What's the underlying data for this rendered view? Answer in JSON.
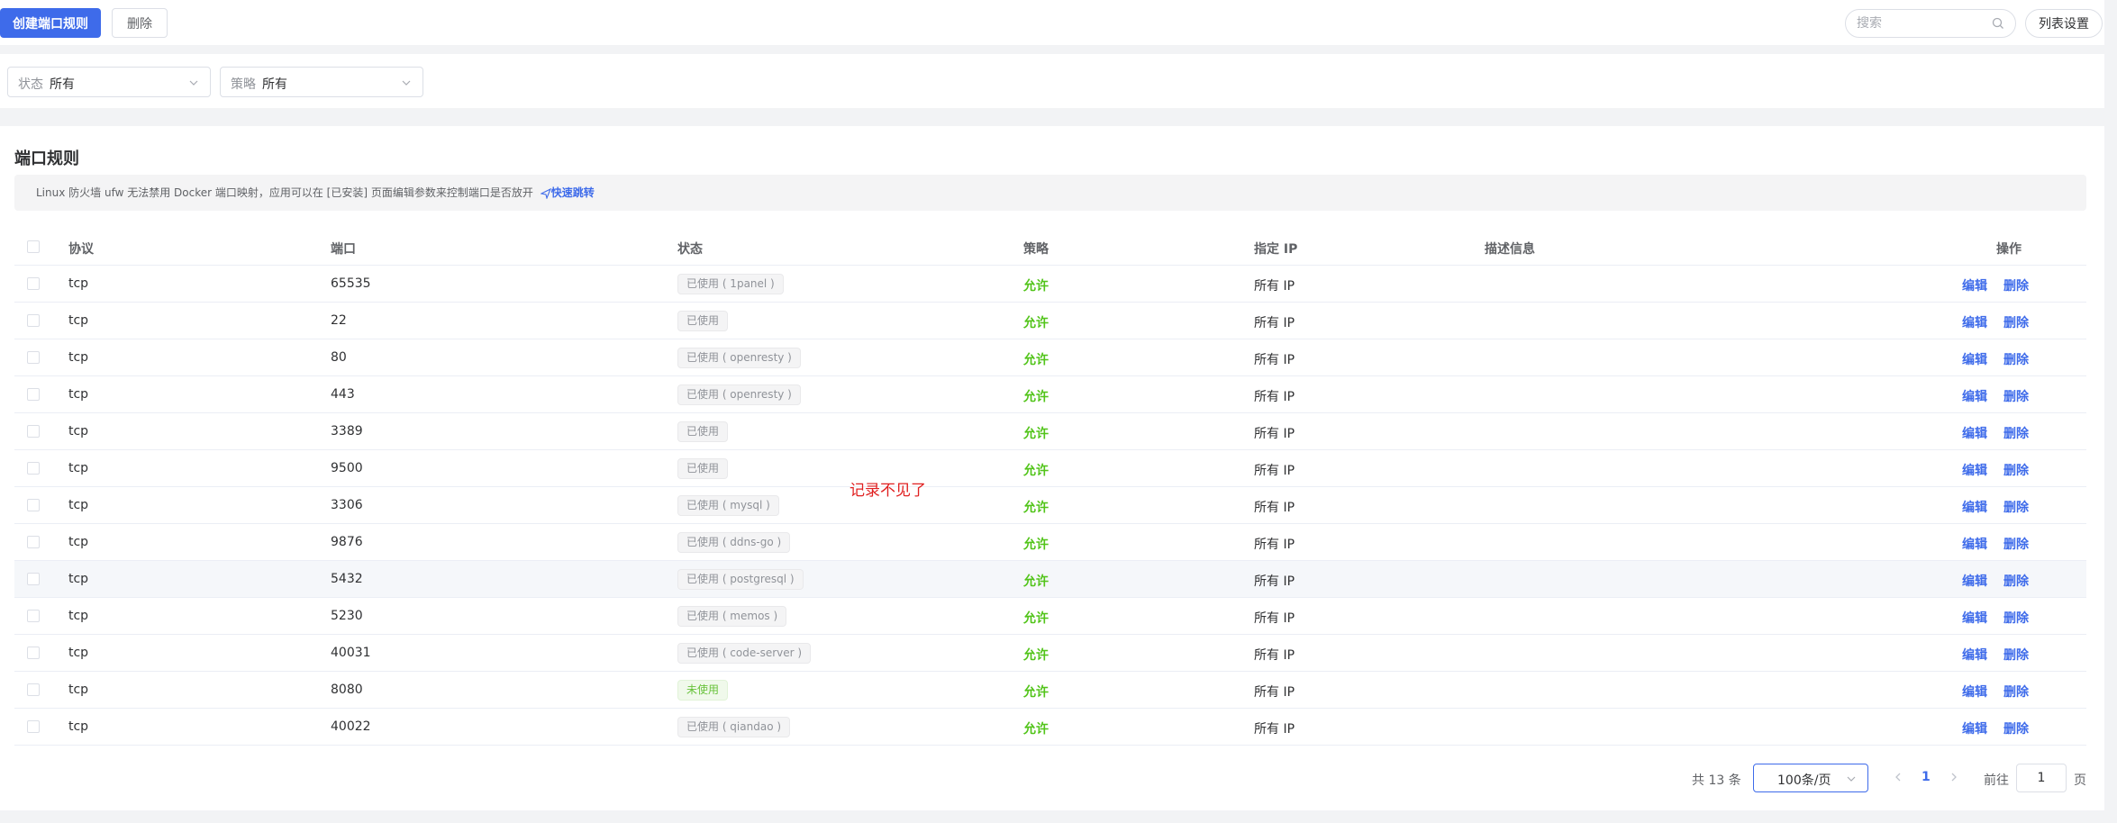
{
  "toolbar": {
    "create_label": "创建端口规则",
    "delete_label": "删除",
    "search_placeholder": "搜索",
    "settings_label": "列表设置"
  },
  "filters": {
    "status_label": "状态",
    "status_value": "所有",
    "policy_label": "策略",
    "policy_value": "所有"
  },
  "card": {
    "title": "端口规则",
    "notice": "Linux 防火墙 ufw 无法禁用 Docker 端口映射，应用可以在 [已安装] 页面编辑参数来控制端口是否放开",
    "notice_link": "快速跳转"
  },
  "table": {
    "headers": [
      "协议",
      "端口",
      "状态",
      "策略",
      "指定 IP",
      "描述信息",
      "操作"
    ],
    "edit_label": "编辑",
    "delete_label": "删除",
    "rows": [
      {
        "protocol": "tcp",
        "port": "65535",
        "status": "已使用 ( 1panel )",
        "used": true,
        "policy": "允许",
        "ip": "所有 IP",
        "desc": ""
      },
      {
        "protocol": "tcp",
        "port": "22",
        "status": "已使用",
        "used": true,
        "policy": "允许",
        "ip": "所有 IP",
        "desc": ""
      },
      {
        "protocol": "tcp",
        "port": "80",
        "status": "已使用 ( openresty )",
        "used": true,
        "policy": "允许",
        "ip": "所有 IP",
        "desc": ""
      },
      {
        "protocol": "tcp",
        "port": "443",
        "status": "已使用 ( openresty )",
        "used": true,
        "policy": "允许",
        "ip": "所有 IP",
        "desc": ""
      },
      {
        "protocol": "tcp",
        "port": "3389",
        "status": "已使用",
        "used": true,
        "policy": "允许",
        "ip": "所有 IP",
        "desc": ""
      },
      {
        "protocol": "tcp",
        "port": "9500",
        "status": "已使用",
        "used": true,
        "policy": "允许",
        "ip": "所有 IP",
        "desc": ""
      },
      {
        "protocol": "tcp",
        "port": "3306",
        "status": "已使用 ( mysql )",
        "used": true,
        "policy": "允许",
        "ip": "所有 IP",
        "desc": ""
      },
      {
        "protocol": "tcp",
        "port": "9876",
        "status": "已使用 ( ddns-go )",
        "used": true,
        "policy": "允许",
        "ip": "所有 IP",
        "desc": ""
      },
      {
        "protocol": "tcp",
        "port": "5432",
        "status": "已使用 ( postgresql )",
        "used": true,
        "policy": "允许",
        "ip": "所有 IP",
        "desc": ""
      },
      {
        "protocol": "tcp",
        "port": "5230",
        "status": "已使用 ( memos )",
        "used": true,
        "policy": "允许",
        "ip": "所有 IP",
        "desc": ""
      },
      {
        "protocol": "tcp",
        "port": "40031",
        "status": "已使用 ( code-server )",
        "used": true,
        "policy": "允许",
        "ip": "所有 IP",
        "desc": ""
      },
      {
        "protocol": "tcp",
        "port": "8080",
        "status": "未使用",
        "used": false,
        "policy": "允许",
        "ip": "所有 IP",
        "desc": ""
      },
      {
        "protocol": "tcp",
        "port": "40022",
        "status": "已使用 ( qiandao )",
        "used": true,
        "policy": "允许",
        "ip": "所有 IP",
        "desc": ""
      }
    ]
  },
  "annotation": "记录不见了",
  "pagination": {
    "total": "共 13 条",
    "page_size": "100条/页",
    "current_page": "1",
    "goto_label": "前往",
    "goto_value": "1",
    "page_unit": "页"
  },
  "colors": {
    "primary": "#3e6bea",
    "allow": "#52c41a",
    "annotation": "#e02020"
  }
}
